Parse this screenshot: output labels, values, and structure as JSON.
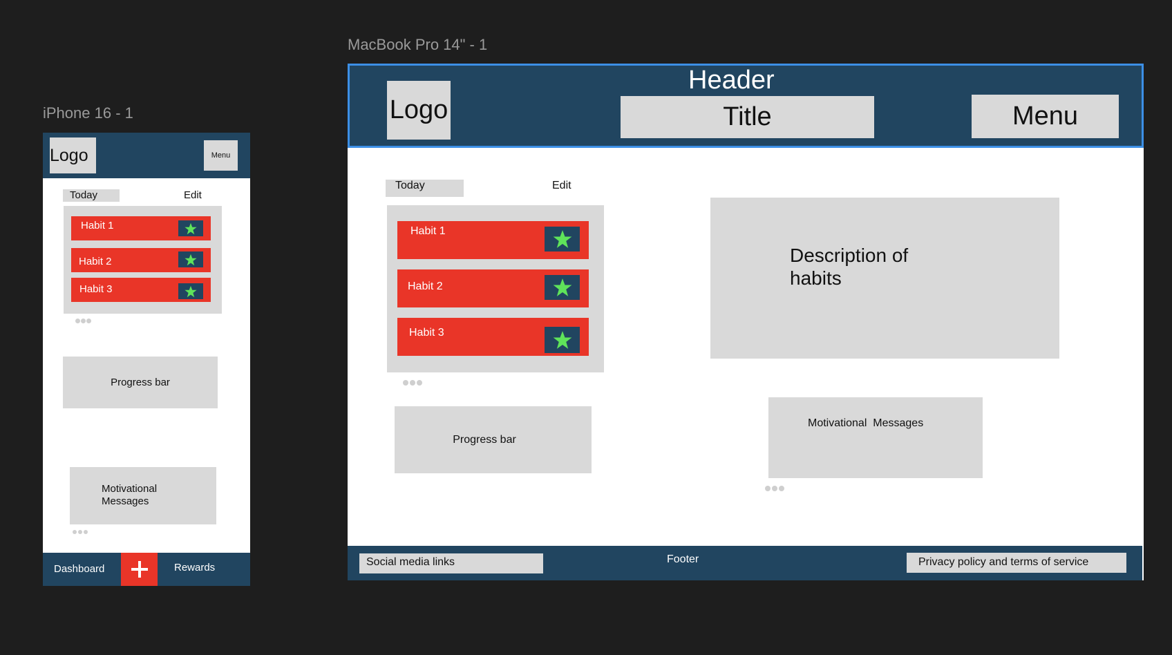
{
  "canvas": {
    "background": "#1e1e1e"
  },
  "colors": {
    "navy": "#214560",
    "red": "#e93528",
    "gray": "#d9d9d9",
    "star": "#5fe35a",
    "selection": "#3c8fe6"
  },
  "iphone": {
    "frame_label": "iPhone 16 - 1",
    "logo": "Logo",
    "menu": "Menu",
    "today": "Today",
    "edit": "Edit",
    "habits": [
      {
        "label": "Habit 1",
        "icon": "star-icon"
      },
      {
        "label": "Habit 2",
        "icon": "star-icon"
      },
      {
        "label": "Habit 3",
        "icon": "star-icon"
      }
    ],
    "progress_bar": "Progress bar",
    "motivational_line1": "Motivational",
    "motivational_line2": "Messages",
    "nav": {
      "dashboard": "Dashboard",
      "add_icon": "plus-icon",
      "rewards": "Rewards"
    }
  },
  "macbook": {
    "frame_label": "MacBook Pro 14\" - 1",
    "header": "Header",
    "logo": "Logo",
    "title": "Title",
    "menu": "Menu",
    "today": "Today",
    "edit": "Edit",
    "habits": [
      {
        "label": "Habit 1",
        "icon": "star-icon"
      },
      {
        "label": "Habit 2",
        "icon": "star-icon"
      },
      {
        "label": "Habit 3",
        "icon": "star-icon"
      }
    ],
    "description_line1": "Description of",
    "description_line2": "habits",
    "progress_bar": "Progress bar",
    "motivational": "Motivational  Messages",
    "footer": {
      "label": "Footer",
      "social": "Social media links",
      "privacy": "Privacy policy and terms of service"
    }
  }
}
